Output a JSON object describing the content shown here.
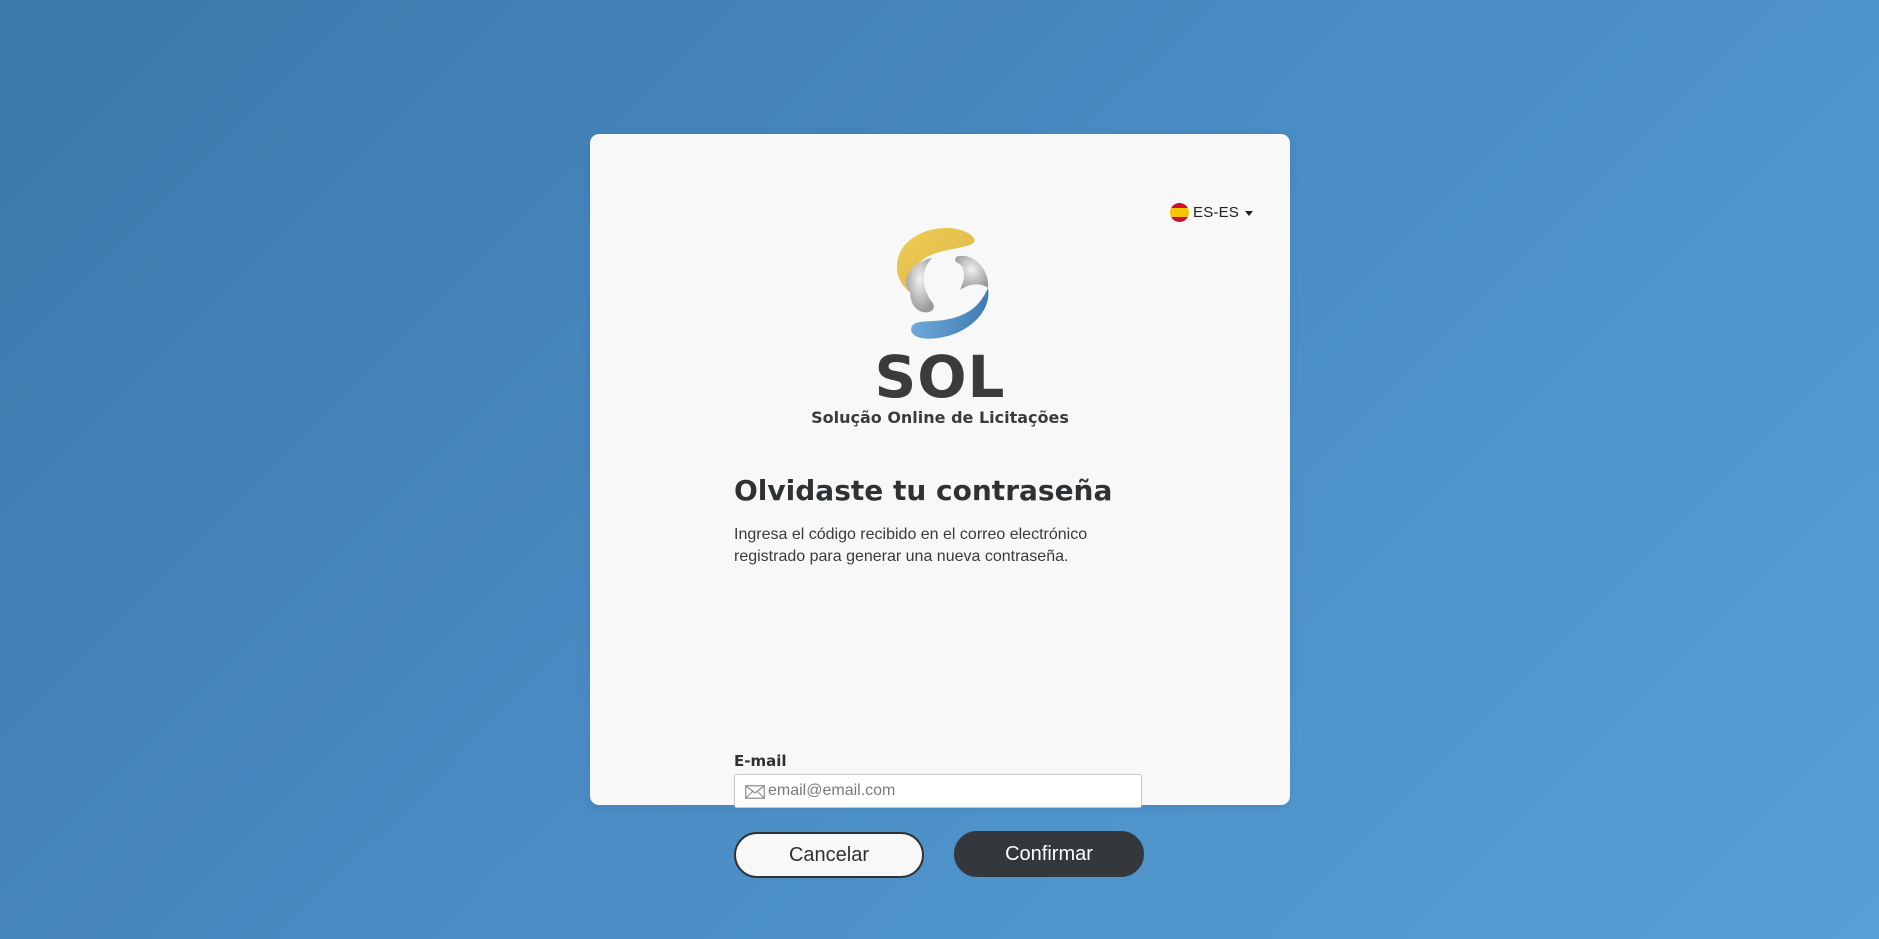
{
  "language_selector": {
    "label": "ES-ES",
    "flag_icon": "spain-flag-icon"
  },
  "logo": {
    "wordmark": "SOL",
    "tagline": "Solução Online de Licitações",
    "colors": {
      "yellow": "#e8c34f",
      "gray": "#b5b5b5",
      "blue": "#4a87bd"
    }
  },
  "form": {
    "title": "Olvidaste tu contraseña",
    "description": "Ingresa el código recibido en el correo electrónico registrado para generar una nueva contraseña.",
    "email_label": "E-mail",
    "email_placeholder": "email@email.com",
    "email_value": "",
    "email_icon": "envelope-icon",
    "cancel_label": "Cancelar",
    "confirm_label": "Confirmar"
  },
  "theme": {
    "background_start": "#3b78ab",
    "background_end": "#57a0d7",
    "card_bg": "#f8f8f8",
    "dark": "#34383c"
  }
}
